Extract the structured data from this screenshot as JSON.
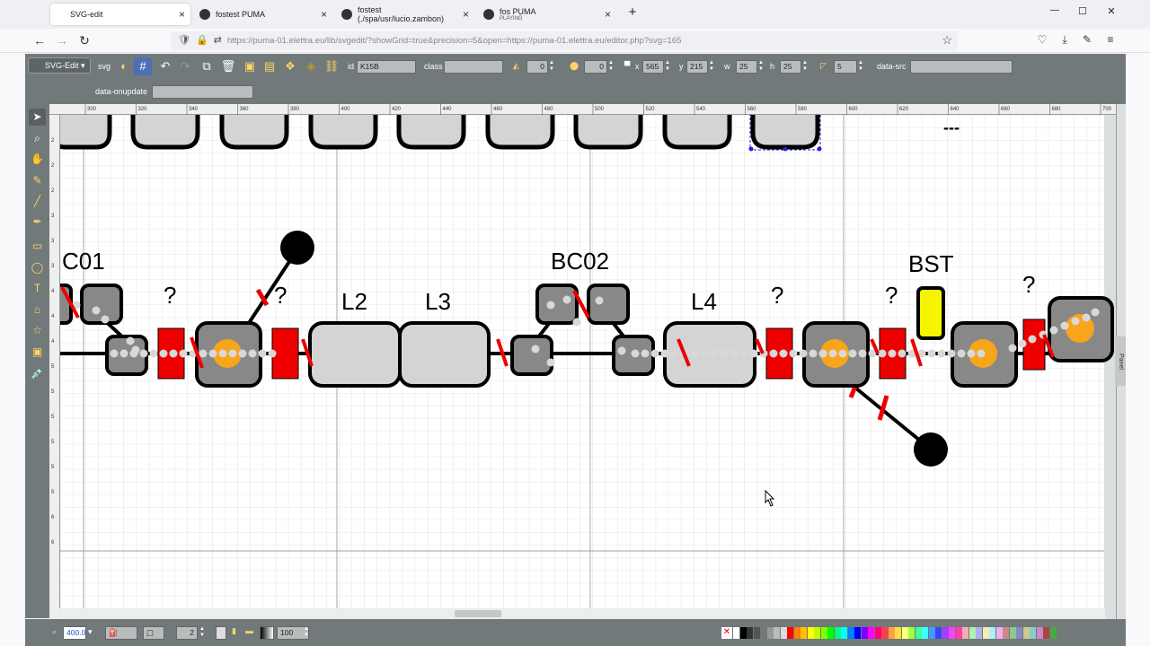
{
  "tabs": [
    {
      "title": "SVG-edit",
      "subtitle": ""
    },
    {
      "title": "fostest PUMA",
      "subtitle": ""
    },
    {
      "title": "fostest (./spa/usr/lucio.zambon)",
      "subtitle": ""
    },
    {
      "title": "fos PUMA",
      "subtitle": "PLAYING"
    }
  ],
  "window": {
    "new_tab": "+",
    "minimize": "—",
    "maximize": "☐",
    "close": "✕"
  },
  "nav": {
    "back": "←",
    "forward": "→",
    "reload": "↻",
    "url": "https://puma-01.elettra.eu/lib/svgedit/?showGrid=true&precision=5&open=https://puma-01.elettra.eu/editor.php?svg=165",
    "bookmark": "☆"
  },
  "toolbar": {
    "mode_button": "SVG-Edit",
    "id_label": "id",
    "id_value": "K15B",
    "class_label": "class",
    "class_value": "",
    "rotation_value": "0",
    "blur_value": "0",
    "x_label": "x",
    "x_value": "565",
    "y_label": "y",
    "y_value": "215",
    "w_label": "w",
    "w_value": "25",
    "h_label": "h",
    "h_value": "25",
    "radius_value": "5",
    "datasrc_label": "data-src",
    "datasrc_value": "",
    "dataonupdate_label": "data-onupdate",
    "dataonupdate_value": ""
  },
  "ruler": {
    "top_ticks": [
      "300",
      "320",
      "340",
      "360",
      "380",
      "400",
      "420",
      "440",
      "460",
      "480",
      "500",
      "520",
      "540",
      "560",
      "580",
      "600",
      "620",
      "640",
      "660",
      "680",
      "700"
    ],
    "left_ticks": [
      "2",
      "2",
      "2",
      "3",
      "3",
      "3",
      "4",
      "4",
      "4",
      "5",
      "5",
      "5",
      "5",
      "5",
      "5",
      "6",
      "6"
    ]
  },
  "diagram": {
    "labels": {
      "c01": "C01",
      "bc02": "BC02",
      "l2": "L2",
      "l3": "L3",
      "l4": "L4",
      "bst": "BST",
      "q1": "?",
      "q2": "?",
      "q3": "?",
      "q4": "?",
      "q5": "?",
      "dashes": "---"
    },
    "colors": {
      "magnet_red": "#ee0000",
      "cavity_gray": "#d4d4d4",
      "block_gray": "#888888",
      "target_orange": "#f7a51b",
      "bst_yellow": "#f5f500",
      "stroke": "#000000"
    }
  },
  "bottom": {
    "zoom": "400.0",
    "stroke_width": "2",
    "opacity": "100",
    "panel_label": "Panel"
  },
  "palette": [
    "#ffffff",
    "#000000",
    "#333333",
    "#555555",
    "#777777",
    "#999999",
    "#bbbbbb",
    "#dddddd",
    "#ff0000",
    "#ff7f00",
    "#ffbf00",
    "#ffff00",
    "#bfff00",
    "#7fff00",
    "#00ff00",
    "#00ff7f",
    "#00ffff",
    "#007fff",
    "#0000ff",
    "#7f00ff",
    "#ff00ff",
    "#ff007f",
    "#ff3f3f",
    "#ff9f3f",
    "#ffdf3f",
    "#ffff7f",
    "#9fff3f",
    "#3fff9f",
    "#3fffff",
    "#3f9fff",
    "#3f3fff",
    "#9f3fff",
    "#ff3fff",
    "#ff3f9f",
    "#f0b0b0",
    "#b0f0b0",
    "#b0b0f0",
    "#f0f0b0",
    "#b0f0f0",
    "#f0b0f0",
    "#c88",
    "#8c8",
    "#88c",
    "#cc8",
    "#8cc",
    "#c8c",
    "#a44",
    "#4a4"
  ]
}
